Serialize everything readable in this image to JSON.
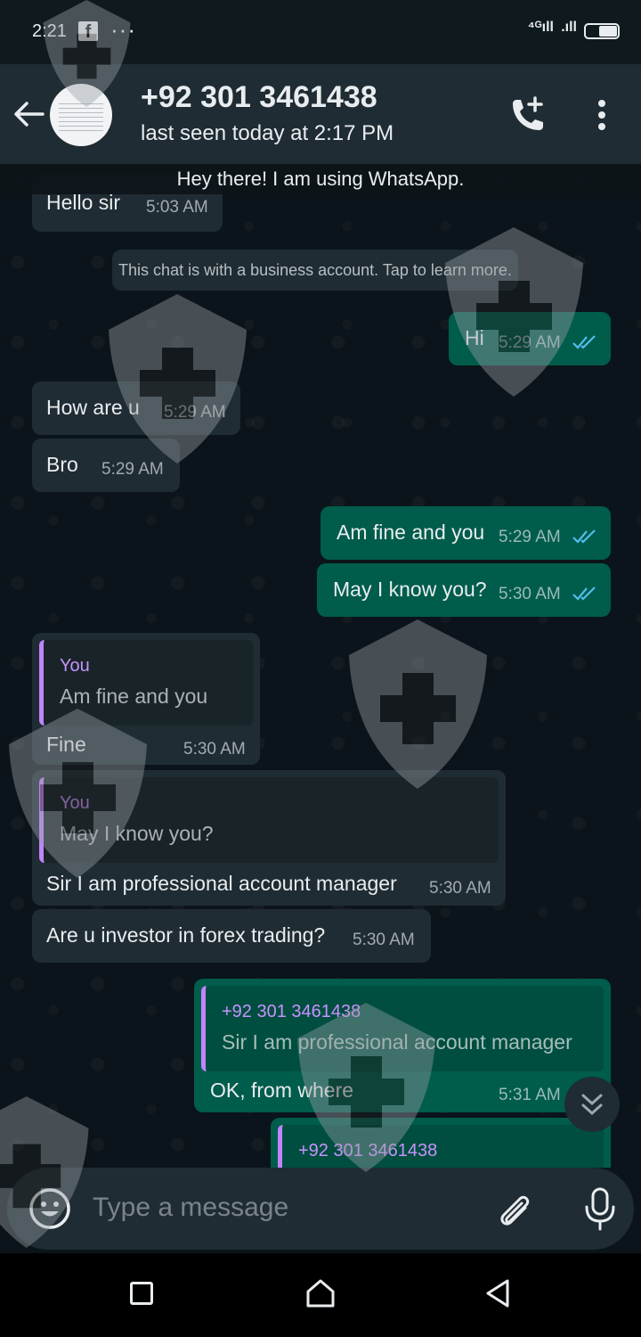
{
  "status_bar": {
    "time": "2:21",
    "fb_glyph": "f",
    "more_glyph": "···",
    "signal_1": "⁴ᴳıll",
    "signal_2": ".ıll"
  },
  "header": {
    "contact_name": "+92 301 3461438",
    "contact_status": "last seen today at 2:17 PM"
  },
  "chat": {
    "about_banner": "Hey there! I am using WhatsApp.",
    "system_notice": "This chat is with a business account. Tap to learn more.",
    "messages": [
      {
        "direction": "in",
        "text": "Hello sir",
        "time": "5:03 AM"
      },
      {
        "direction": "out",
        "text": "Hi",
        "time": "5:29 AM",
        "read": true
      },
      {
        "direction": "in",
        "text": "How are u",
        "time": "5:29 AM"
      },
      {
        "direction": "in",
        "text": "Bro",
        "time": "5:29 AM"
      },
      {
        "direction": "out",
        "text": "Am fine and you",
        "time": "5:29 AM",
        "read": true
      },
      {
        "direction": "out",
        "text": "May I know you?",
        "time": "5:30 AM",
        "read": true
      },
      {
        "direction": "in",
        "text": "Fine",
        "time": "5:30 AM",
        "quote": {
          "author": "You",
          "text": "Am fine and you"
        }
      },
      {
        "direction": "in",
        "text": "Sir I am professional account manager",
        "time": "5:30 AM",
        "quote": {
          "author": "You",
          "text": "May I know you?"
        }
      },
      {
        "direction": "in",
        "text": "Are u investor in forex trading?",
        "time": "5:30 AM"
      },
      {
        "direction": "out",
        "text": "OK, from where",
        "time": "5:31 AM",
        "quote": {
          "author": "+92 301 3461438",
          "text": "Sir I am professional account manager"
        }
      },
      {
        "direction": "out",
        "text": "",
        "time": "",
        "quote": {
          "author": "+92 301 3461438",
          "text": ""
        }
      }
    ]
  },
  "composer": {
    "placeholder": "Type a message"
  },
  "colors": {
    "incoming": "#1f2c33",
    "outgoing": "#005c4b",
    "header": "#1f2c33",
    "read_ticks": "#53bdeb",
    "quote_bar": "#c084fc"
  },
  "icons": [
    "back-arrow-icon",
    "add-call-icon",
    "more-vert-icon",
    "emoji-icon",
    "attach-icon",
    "mic-icon",
    "chevrons-down-icon",
    "nav-recents-icon",
    "nav-home-icon",
    "nav-back-icon"
  ]
}
